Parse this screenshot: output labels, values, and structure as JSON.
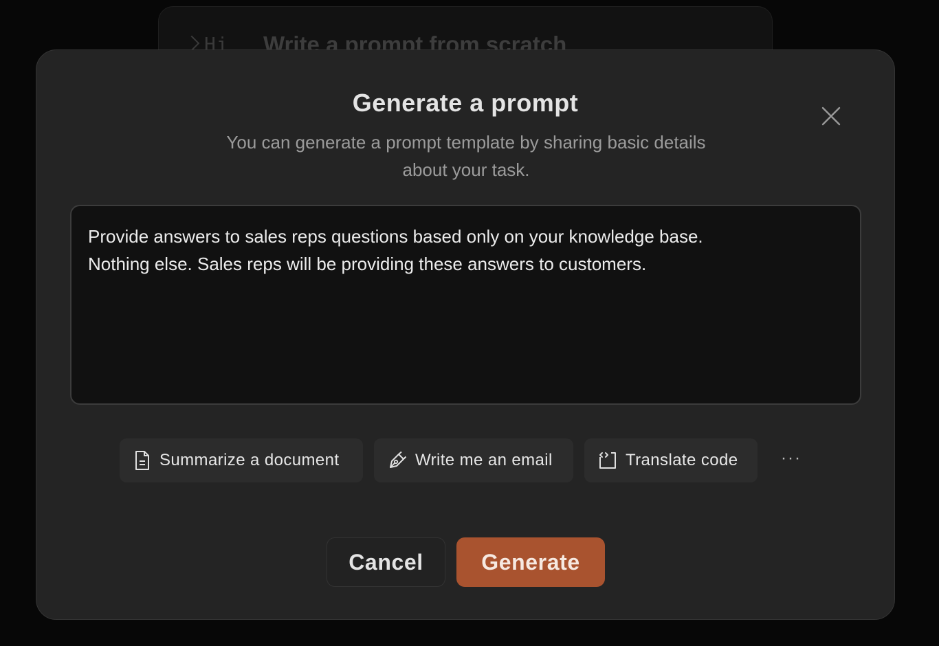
{
  "background_card": {
    "prefix": "Hi",
    "title": "Write a prompt from scratch"
  },
  "modal": {
    "title": "Generate a prompt",
    "subtitle": "You can generate a prompt template by sharing basic details about your task.",
    "close_icon": "close-icon"
  },
  "prompt_input": {
    "value": "Provide answers to sales reps questions based only on your knowledge base.\nNothing else. Sales reps will be providing these answers to customers."
  },
  "suggestions": [
    {
      "label": "Summarize a document",
      "icon": "document-icon"
    },
    {
      "label": "Write me an email",
      "icon": "pen-icon"
    },
    {
      "label": "Translate code",
      "icon": "code-icon"
    }
  ],
  "more_label": "···",
  "actions": {
    "cancel_label": "Cancel",
    "generate_label": "Generate"
  },
  "colors": {
    "page_background": "#070707",
    "modal_background": "#242424",
    "input_background": "#111111",
    "accent": "#a9532f"
  }
}
